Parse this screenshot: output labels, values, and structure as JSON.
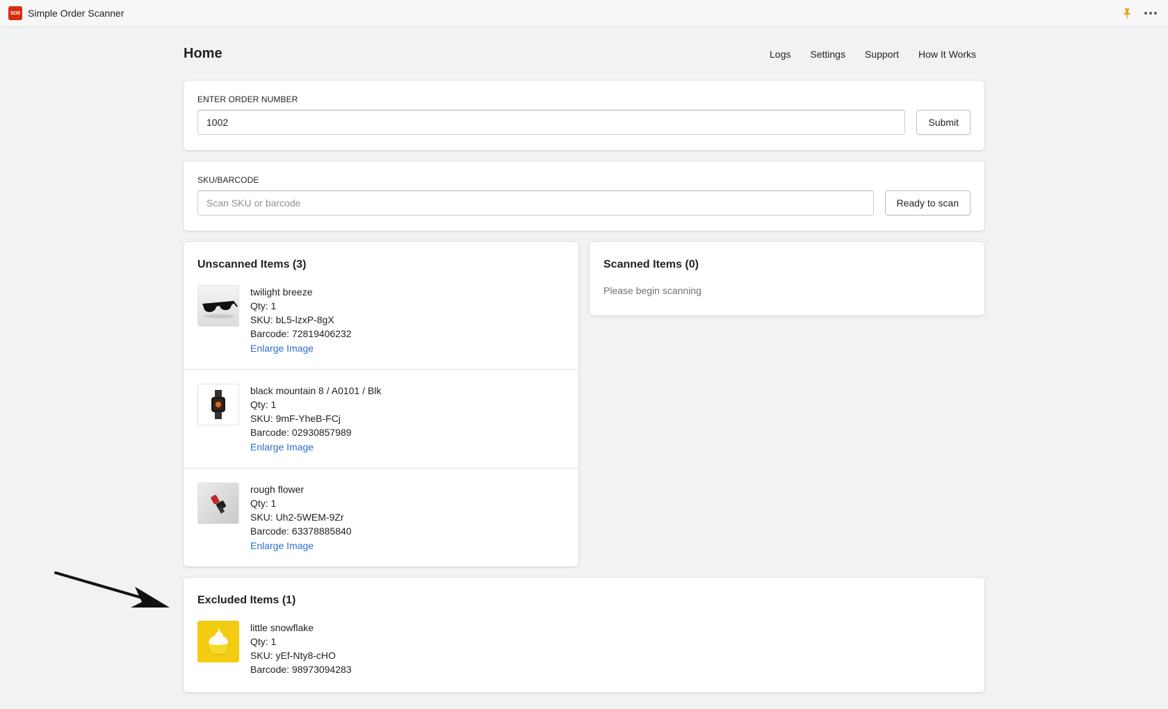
{
  "app": {
    "logo_text": "SOS",
    "title": "Simple Order Scanner",
    "pin_icon": "pin-icon",
    "more_icon": "more-horizontal-icon"
  },
  "page": {
    "title": "Home",
    "nav": [
      "Logs",
      "Settings",
      "Support",
      "How It Works"
    ]
  },
  "order": {
    "label": "ENTER ORDER NUMBER",
    "value": "1002",
    "submit_label": "Submit"
  },
  "sku": {
    "label": "SKU/BARCODE",
    "placeholder": "Scan SKU or barcode",
    "button_label": "Ready to scan"
  },
  "unscanned": {
    "title": "Unscanned Items (3)",
    "items": [
      {
        "name": "twilight breeze",
        "qty": "Qty: 1",
        "sku": "SKU: bL5-lzxP-8gX",
        "barcode": "Barcode: 72819406232",
        "link": "Enlarge Image",
        "image": "sunglasses"
      },
      {
        "name": "black mountain 8 / A0101 / Blk",
        "qty": "Qty: 1",
        "sku": "SKU: 9mF-YheB-FCj",
        "barcode": "Barcode: 02930857989",
        "link": "Enlarge Image",
        "image": "smartwatch"
      },
      {
        "name": "rough flower",
        "qty": "Qty: 1",
        "sku": "SKU: Uh2-5WEM-9Zr",
        "barcode": "Barcode: 63378885840",
        "link": "Enlarge Image",
        "image": "gadget"
      }
    ]
  },
  "scanned": {
    "title": "Scanned Items (0)",
    "empty": "Please begin scanning"
  },
  "excluded": {
    "title": "Excluded Items (1)",
    "items": [
      {
        "name": "little snowflake",
        "qty": "Qty: 1",
        "sku": "SKU: yEf-Nty8-cHO",
        "barcode": "Barcode: 98973094283",
        "image": "cupcake"
      }
    ]
  },
  "colors": {
    "accent_link": "#2c6ecb",
    "logo_red": "#d82c0d",
    "pin_orange": "#e8a317",
    "background": "#f1f2f4"
  }
}
